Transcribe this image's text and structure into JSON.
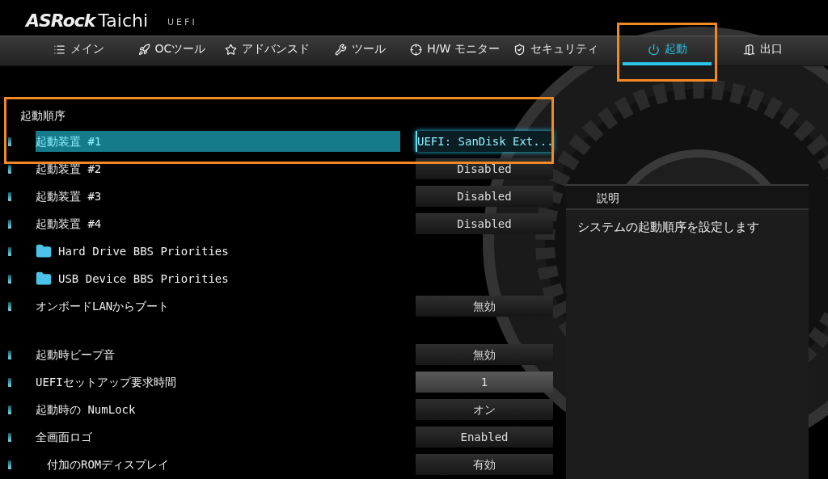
{
  "brand": {
    "logo": "ASRock",
    "model": "Taichi",
    "firmware": "UEFI"
  },
  "tabs": [
    {
      "label": "メイン",
      "selected": false
    },
    {
      "label": "OCツール",
      "selected": false
    },
    {
      "label": "アドバンスド",
      "selected": false
    },
    {
      "label": "ツール",
      "selected": false
    },
    {
      "label": "H/W モニター",
      "selected": false
    },
    {
      "label": "セキュリティ",
      "selected": false
    },
    {
      "label": "起動",
      "selected": true
    },
    {
      "label": "出口",
      "selected": false
    }
  ],
  "sections": [
    {
      "heading": "起動順序",
      "items": [
        {
          "kind": "option",
          "label": "起動装置 #1",
          "value": "UEFI: SanDisk Ext...",
          "selected": true
        },
        {
          "kind": "option",
          "label": "起動装置 #2",
          "value": "Disabled",
          "selected": false
        },
        {
          "kind": "option",
          "label": "起動装置 #3",
          "value": "Disabled",
          "selected": false
        },
        {
          "kind": "option",
          "label": "起動装置 #4",
          "value": "Disabled",
          "selected": false
        },
        {
          "kind": "folder",
          "label": "Hard Drive BBS Priorities",
          "selected": false
        },
        {
          "kind": "folder",
          "label": "USB Device BBS Priorities",
          "selected": false
        },
        {
          "kind": "option",
          "label": "オンボードLANからブート",
          "value": "無効",
          "selected": false
        }
      ]
    },
    {
      "items": [
        {
          "kind": "option",
          "label": "起動時ビープ音",
          "value": "無効",
          "selected": false
        },
        {
          "kind": "number",
          "label": "UEFIセットアップ要求時間",
          "value": "1",
          "selected": false
        },
        {
          "kind": "option",
          "label": "起動時の NumLock",
          "value": "オン",
          "selected": false
        },
        {
          "kind": "option",
          "label": "全画面ロゴ",
          "value": "Enabled",
          "selected": false,
          "children": [
            {
              "kind": "option",
              "label": "付加のROMディスプレイ",
              "value": "有効",
              "selected": false
            }
          ]
        }
      ]
    }
  ],
  "description": {
    "title": "説明",
    "text": "システムの起動順序を設定します"
  }
}
